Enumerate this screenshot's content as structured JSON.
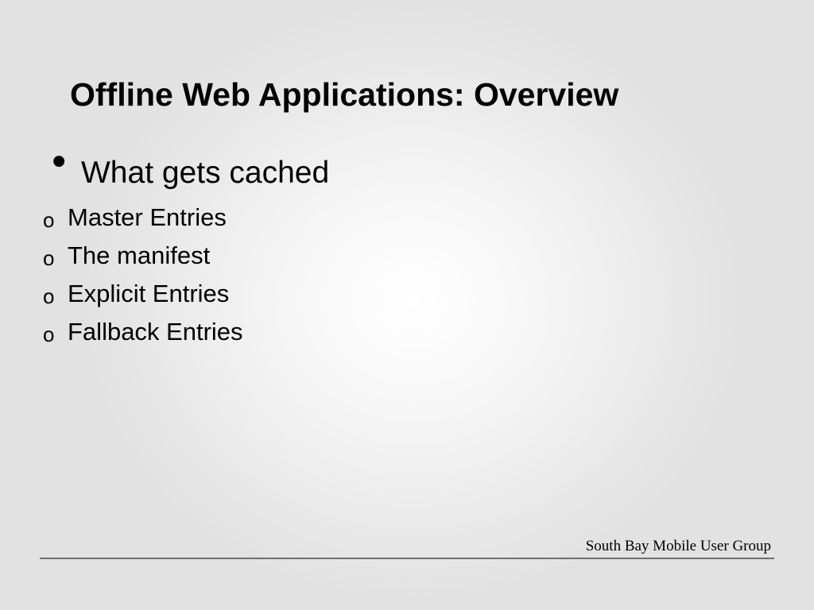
{
  "slide": {
    "title": "Offline Web Applications: Overview",
    "bullets": [
      {
        "marker": "•",
        "text": "What gets cached",
        "children": [
          {
            "marker": "o",
            "text": "Master Entries"
          },
          {
            "marker": "o",
            "text": "The manifest"
          },
          {
            "marker": "o",
            "text": "Explicit Entries"
          },
          {
            "marker": "o",
            "text": "Fallback Entries"
          }
        ]
      }
    ],
    "footer": "South Bay Mobile User Group"
  },
  "colors": {
    "text": "#000000",
    "background_center": "#ffffff",
    "background_edge": "#e2e2e2",
    "footer_rule": "#6e6e6e"
  }
}
